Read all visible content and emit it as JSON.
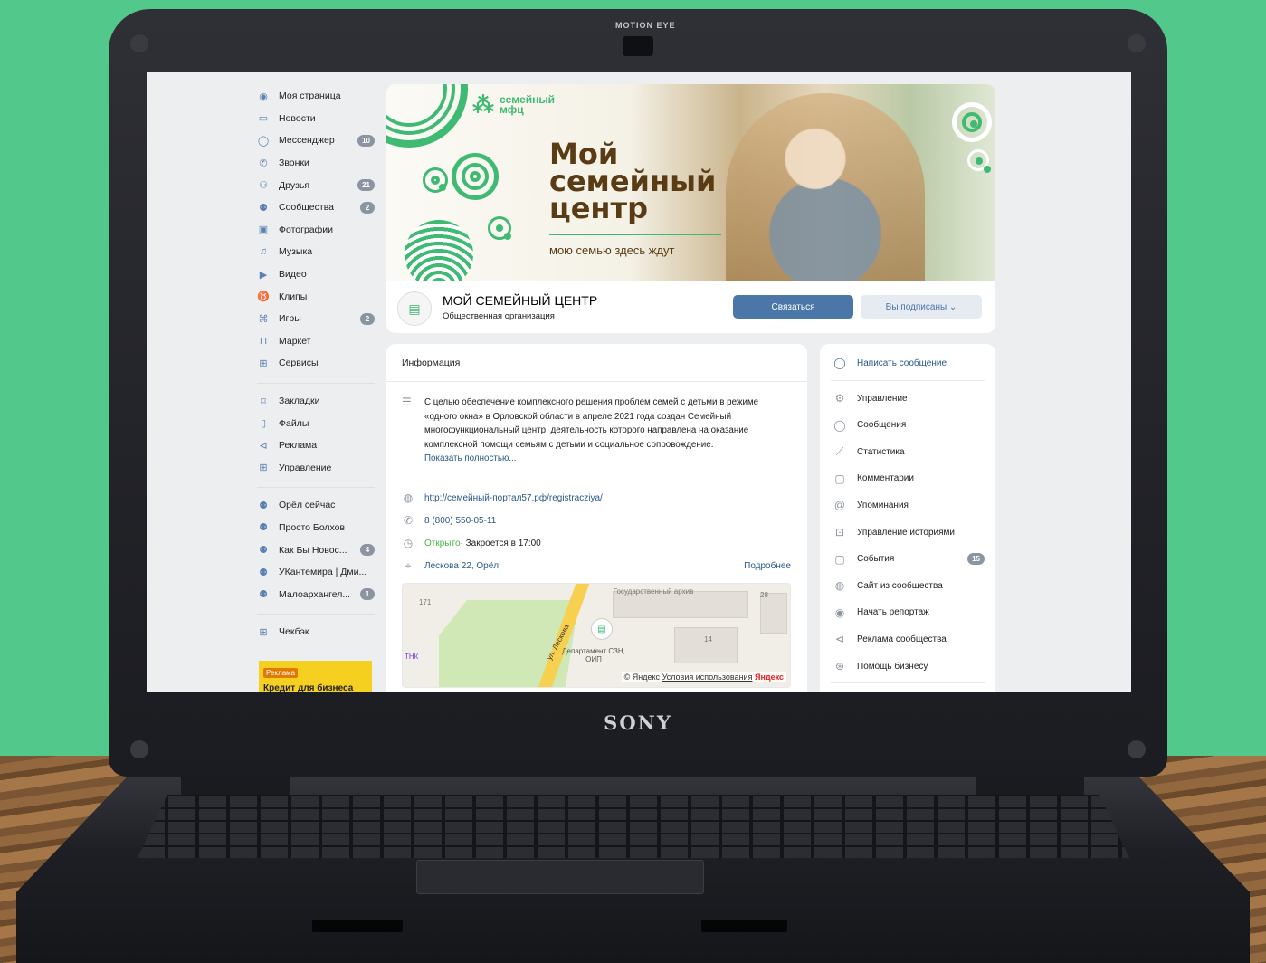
{
  "hardware": {
    "camera_label": "MOTION EYE",
    "brand": "SONY"
  },
  "sidebar": {
    "items": [
      {
        "label": "Моя страница",
        "icon": "user-circle-icon",
        "badge": ""
      },
      {
        "label": "Новости",
        "icon": "news-icon",
        "badge": ""
      },
      {
        "label": "Мессенджер",
        "icon": "chat-bubble-icon",
        "badge": "10"
      },
      {
        "label": "Звонки",
        "icon": "phone-icon",
        "badge": ""
      },
      {
        "label": "Друзья",
        "icon": "friends-icon",
        "badge": "21"
      },
      {
        "label": "Сообщества",
        "icon": "communities-icon",
        "badge": "2"
      },
      {
        "label": "Фотографии",
        "icon": "photo-icon",
        "badge": ""
      },
      {
        "label": "Музыка",
        "icon": "music-icon",
        "badge": ""
      },
      {
        "label": "Видео",
        "icon": "video-icon",
        "badge": ""
      },
      {
        "label": "Клипы",
        "icon": "clips-icon",
        "badge": ""
      },
      {
        "label": "Игры",
        "icon": "gamepad-icon",
        "badge": "2"
      },
      {
        "label": "Маркет",
        "icon": "bag-icon",
        "badge": ""
      },
      {
        "label": "Сервисы",
        "icon": "grid-icon",
        "badge": ""
      }
    ],
    "items2": [
      {
        "label": "Закладки",
        "icon": "bookmark-icon",
        "badge": ""
      },
      {
        "label": "Файлы",
        "icon": "file-icon",
        "badge": ""
      },
      {
        "label": "Реклама",
        "icon": "megaphone-icon",
        "badge": ""
      },
      {
        "label": "Управление",
        "icon": "grid-icon",
        "badge": ""
      }
    ],
    "items3": [
      {
        "label": "Орёл сейчас",
        "icon": "communities-icon",
        "badge": ""
      },
      {
        "label": "Просто Болхов",
        "icon": "communities-icon",
        "badge": ""
      },
      {
        "label": "Как Бы Новос...",
        "icon": "communities-icon",
        "badge": "4"
      },
      {
        "label": "УКантемира | Дми...",
        "icon": "communities-icon",
        "badge": ""
      },
      {
        "label": "Малоархангел...",
        "icon": "communities-icon",
        "badge": "1"
      }
    ],
    "items4": [
      {
        "label": "Чекбэк",
        "icon": "grid-icon",
        "badge": ""
      }
    ],
    "ad": {
      "tag": "Реклама",
      "title": "Кредит для бизнеса"
    }
  },
  "cover": {
    "brand_line1": "семейный",
    "brand_line2": "мфц",
    "title_line1": "Мой",
    "title_line2": "семейный",
    "title_line3": "центр",
    "subtitle": "мою семью здесь ждут"
  },
  "group": {
    "name": "МОЙ СЕМЕЙНЫЙ ЦЕНТР",
    "type": "Общественная организация",
    "contact_label": "Связаться",
    "subscribed_label": "Вы подписаны ⌄"
  },
  "info": {
    "heading": "Информация",
    "description": "С целью обеспечение комплексного решения проблем семей с детьми в режиме «одного окна» в Орловской области в апреле 2021 года создан Семейный многофункциональный центр, деятельность которого направлена на оказание комплексной помощи семьям с детьми и социальное сопровождение.",
    "show_more": "Показать полностью...",
    "website": "http://семейный-портал57.рф/registracziya/",
    "phone": "8 (800) 550-05-11",
    "open_status": "Открыто",
    "hours": " · Закроется в 17:00",
    "address": "Лескова 22, Орёл",
    "details_link": "Подробнее",
    "map": {
      "street": "ул. Лескова",
      "label_archive": "Государственный архив",
      "label_dept": "Департамент СЗН, ОИП",
      "label_tnk": "ТНК",
      "num_171": "171",
      "num_14": "14",
      "num_28": "28",
      "copyright": "© Яндекс",
      "terms": "Условия использования",
      "yandex": "Яндекс"
    }
  },
  "menu": {
    "write_message": "Написать сообщение",
    "items": [
      {
        "label": "Управление",
        "icon": "gear-icon",
        "badge": ""
      },
      {
        "label": "Сообщения",
        "icon": "chat-bubble-icon",
        "badge": ""
      },
      {
        "label": "Статистика",
        "icon": "stats-icon",
        "badge": ""
      },
      {
        "label": "Комментарии",
        "icon": "comment-icon",
        "badge": ""
      },
      {
        "label": "Упоминания",
        "icon": "at-icon",
        "badge": ""
      },
      {
        "label": "Управление историями",
        "icon": "stories-icon",
        "badge": ""
      },
      {
        "label": "События",
        "icon": "event-icon",
        "badge": "15"
      },
      {
        "label": "Сайт из сообщества",
        "icon": "globe-icon",
        "badge": ""
      },
      {
        "label": "Начать репортаж",
        "icon": "broadcast-icon",
        "badge": ""
      },
      {
        "label": "Реклама сообщества",
        "icon": "megaphone-icon",
        "badge": ""
      },
      {
        "label": "Помощь бизнесу",
        "icon": "business-icon",
        "badge": ""
      }
    ]
  }
}
